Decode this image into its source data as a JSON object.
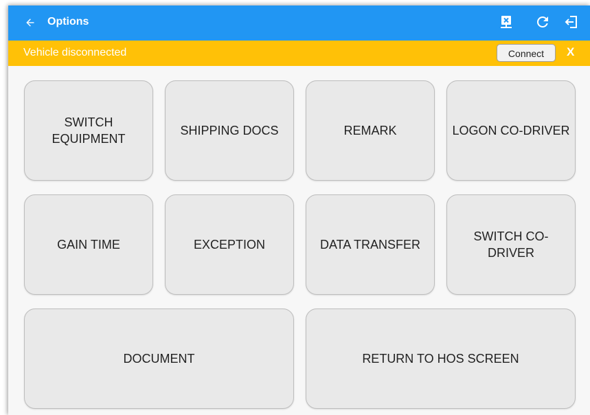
{
  "header": {
    "title": "Options",
    "background_color": "#2196f3",
    "icons": [
      "back-arrow-icon",
      "disconnected-device-icon",
      "refresh-icon",
      "logout-icon"
    ]
  },
  "banner": {
    "status_text": "Vehicle disconnected",
    "connect_label": "Connect",
    "close_label": "X",
    "background_color": "#ffc107"
  },
  "options": {
    "switch_equipment": "SWITCH EQUIPMENT",
    "shipping_docs": "SHIPPING DOCS",
    "remark": "REMARK",
    "logon_co_driver": "LOGON CO-DRIVER",
    "gain_time": "GAIN TIME",
    "exception": "EXCEPTION",
    "data_transfer": "DATA TRANSFER",
    "switch_co_driver": "SWITCH CO-DRIVER",
    "document": "DOCUMENT",
    "return_to_hos": "RETURN TO HOS SCREEN"
  }
}
